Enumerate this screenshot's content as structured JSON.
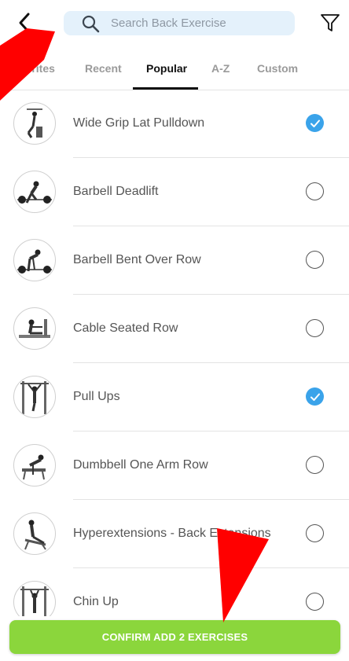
{
  "header": {
    "search_placeholder": "Search Back Exercise"
  },
  "tabs": [
    {
      "label": "vorites",
      "active": false
    },
    {
      "label": "Recent",
      "active": false
    },
    {
      "label": "Popular",
      "active": true
    },
    {
      "label": "A-Z",
      "active": false
    },
    {
      "label": "Custom",
      "active": false
    }
  ],
  "exercises": [
    {
      "name": "Wide Grip Lat Pulldown",
      "selected": true
    },
    {
      "name": "Barbell Deadlift",
      "selected": false
    },
    {
      "name": "Barbell Bent Over Row",
      "selected": false
    },
    {
      "name": "Cable Seated Row",
      "selected": false
    },
    {
      "name": "Pull Ups",
      "selected": true
    },
    {
      "name": "Dumbbell One Arm Row",
      "selected": false
    },
    {
      "name": "Hyperextensions - Back Extensions",
      "selected": false
    },
    {
      "name": "Chin Up",
      "selected": false
    }
  ],
  "confirm": {
    "label": "CONFIRM ADD 2 EXERCISES"
  },
  "colors": {
    "accent_blue": "#3aa3ea",
    "confirm_green": "#8bd63c",
    "search_bg": "#e4f1fb",
    "annotation_red": "#ff0000"
  },
  "icons": {
    "back": "chevron-left-icon",
    "search": "magnifier-icon",
    "filter": "funnel-icon",
    "checked": "checkmark-icon"
  }
}
